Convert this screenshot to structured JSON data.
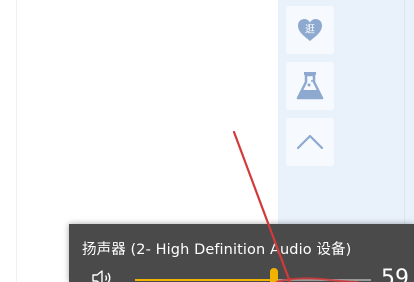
{
  "side_toolbar": {
    "guang_icon": "heart-guang-icon",
    "lab_icon": "flask-icon",
    "top_icon": "chevron-up-icon",
    "guang_label": "逛"
  },
  "volume_flyout": {
    "device_name": "扬声器 (2- High Definition Audio 设备)",
    "speaker_icon": "speaker-icon",
    "volume_level": 59,
    "volume_text": "59",
    "accent_color": "#f2b300"
  },
  "colors": {
    "panel_bg": "#e9f1fb",
    "flyout_bg": "#4a4a4a",
    "annotation_arrow": "#d23a3a"
  }
}
